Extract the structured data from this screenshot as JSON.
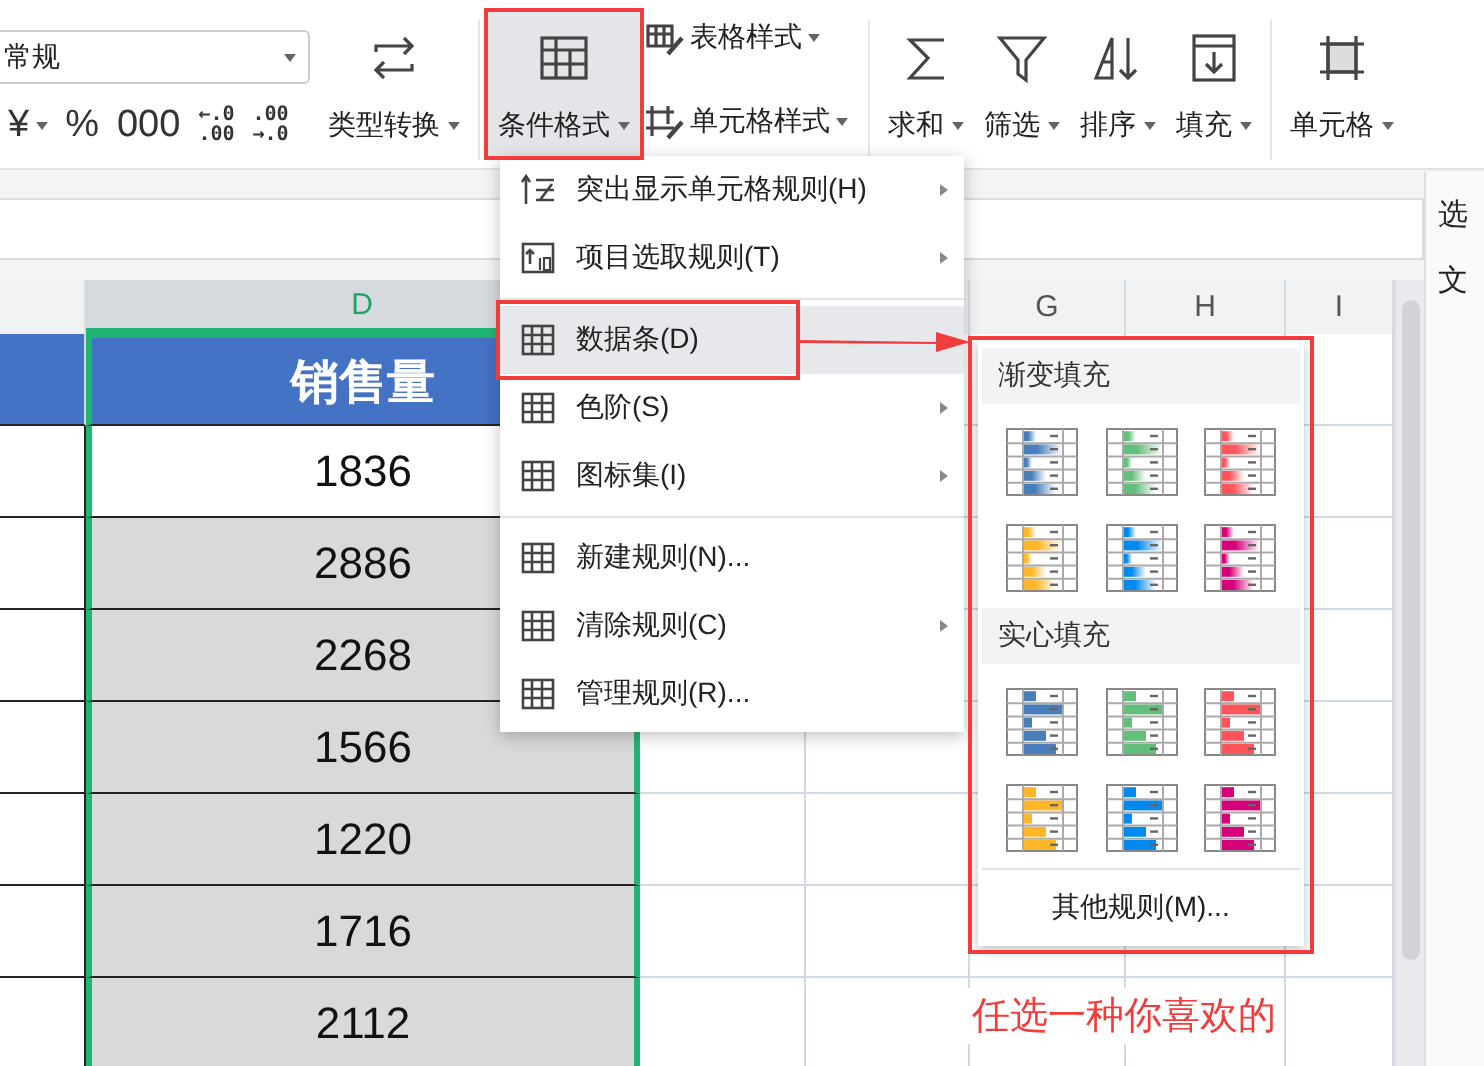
{
  "ribbon": {
    "number_format": {
      "value": "常规"
    },
    "format_buttons": [
      {
        "kind": "text",
        "label": "¥",
        "dropdown": true
      },
      {
        "kind": "text",
        "label": "%",
        "dropdown": false
      },
      {
        "kind": "text",
        "label": "000",
        "dropdown": false
      },
      {
        "kind": "decimal",
        "top": "←.0",
        "bottom": ".00"
      },
      {
        "kind": "decimal",
        "top": ".00",
        "bottom": "→.0"
      }
    ],
    "groups": [
      [
        {
          "kind": "large",
          "label": "类型转换",
          "selected": false,
          "annotated": false
        }
      ],
      [
        {
          "kind": "large",
          "label": "条件格式",
          "selected": true,
          "annotated": true
        },
        {
          "kind": "stack",
          "buttons": [
            {
              "label": "表格样式"
            },
            {
              "label": "单元格样式"
            }
          ]
        }
      ],
      [
        {
          "kind": "large",
          "label": "求和",
          "selected": false,
          "annotated": false
        },
        {
          "kind": "large",
          "label": "筛选",
          "selected": false,
          "annotated": false
        },
        {
          "kind": "large",
          "label": "排序",
          "selected": false,
          "annotated": false
        },
        {
          "kind": "large",
          "label": "填充",
          "selected": false,
          "annotated": false
        }
      ],
      [
        {
          "kind": "large",
          "label": "单元格",
          "selected": false,
          "annotated": false
        }
      ]
    ]
  },
  "sheet": {
    "column_headers": [
      {
        "label": "D",
        "selected": true
      },
      {
        "label": "G",
        "selected": false
      },
      {
        "label": "H",
        "selected": false
      },
      {
        "label": "I",
        "selected": false
      }
    ],
    "header_cell": "销售量",
    "rows": [
      {
        "value": "1836",
        "shaded": false
      },
      {
        "value": "2886",
        "shaded": true
      },
      {
        "value": "2268",
        "shaded": true
      },
      {
        "value": "1566",
        "shaded": true
      },
      {
        "value": "1220",
        "shaded": true
      },
      {
        "value": "1716",
        "shaded": true
      },
      {
        "value": "2112",
        "shaded": true
      }
    ]
  },
  "side_panel": {
    "texts": [
      "选",
      "文"
    ]
  },
  "menu": {
    "groups": [
      [
        {
          "label": "突出显示单元格规则(H)",
          "submenu": true,
          "selected": false,
          "annotated": false
        },
        {
          "label": "项目选取规则(T)",
          "submenu": true,
          "selected": false,
          "annotated": false
        }
      ],
      [
        {
          "label": "数据条(D)",
          "submenu": true,
          "selected": true,
          "annotated": true
        },
        {
          "label": "色阶(S)",
          "submenu": true,
          "selected": false,
          "annotated": false
        },
        {
          "label": "图标集(I)",
          "submenu": true,
          "selected": false,
          "annotated": false
        }
      ],
      [
        {
          "label": "新建规则(N)...",
          "submenu": false,
          "selected": false,
          "annotated": false
        },
        {
          "label": "清除规则(C)",
          "submenu": true,
          "selected": false,
          "annotated": false
        },
        {
          "label": "管理规则(R)...",
          "submenu": false,
          "selected": false,
          "annotated": false
        }
      ]
    ]
  },
  "submenu": {
    "annotated": true,
    "sections": [
      {
        "title": "渐变填充",
        "kind": "gradient",
        "options": [
          {
            "color": "#4a7ebb"
          },
          {
            "color": "#63be7b"
          },
          {
            "color": "#ff555a"
          },
          {
            "color": "#ffb628"
          },
          {
            "color": "#008aef"
          },
          {
            "color": "#d6007b"
          }
        ]
      },
      {
        "title": "实心填充",
        "kind": "solid",
        "options": [
          {
            "color": "#4a7ebb"
          },
          {
            "color": "#63be7b"
          },
          {
            "color": "#ff555a"
          },
          {
            "color": "#ffb628"
          },
          {
            "color": "#008aef"
          },
          {
            "color": "#d6007b"
          }
        ]
      }
    ],
    "more": "其他规则(M)..."
  },
  "annotation": {
    "note": "任选一种你喜欢的"
  }
}
